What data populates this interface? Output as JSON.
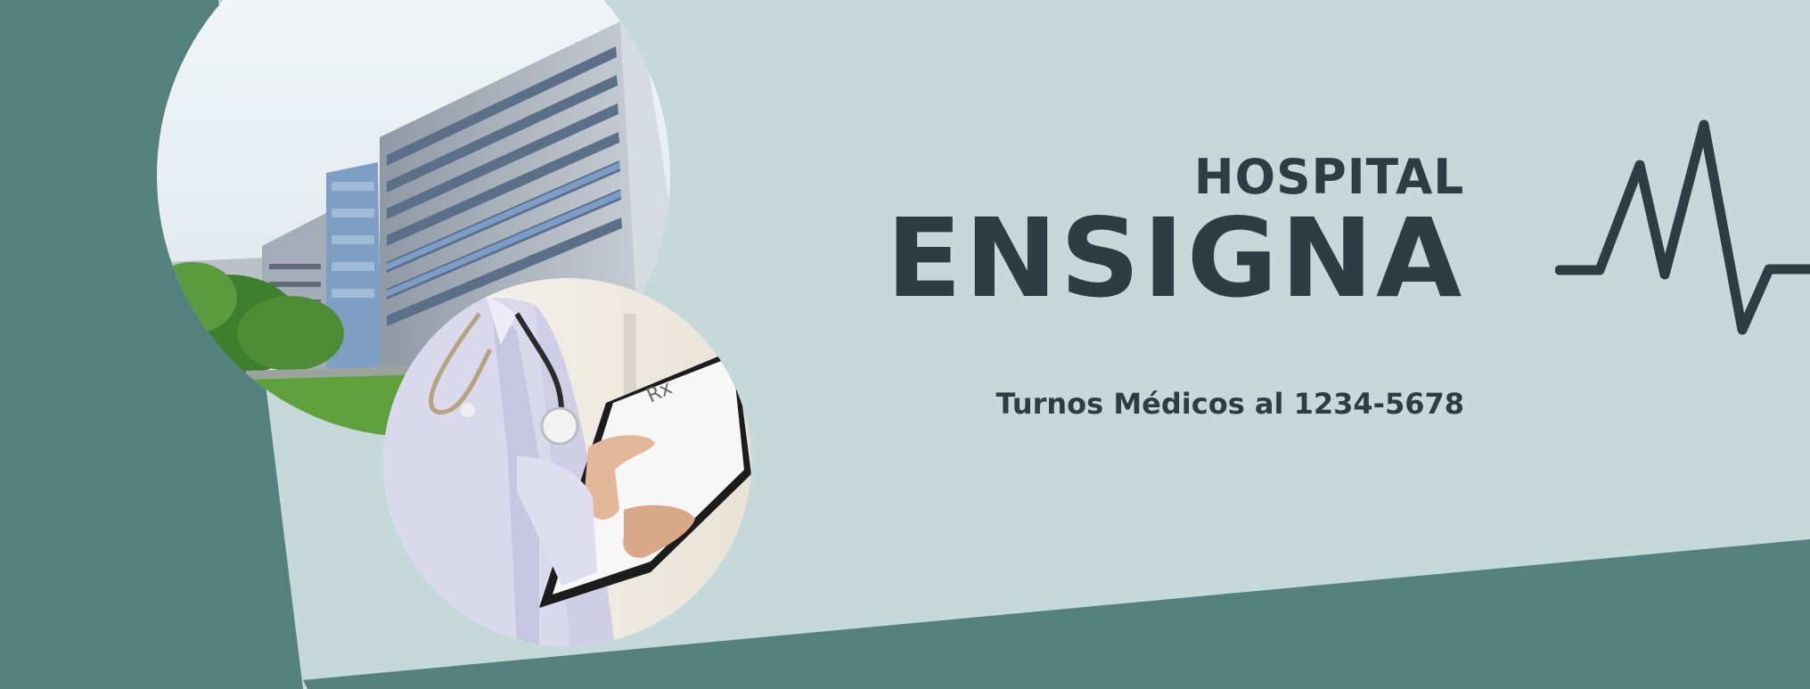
{
  "banner": {
    "title_small": "HOSPITAL",
    "title_big": "ENSIGNA",
    "subtitle": "Turnos Médicos al 1234-5678"
  },
  "images": {
    "building": "hospital-building-photo",
    "doctor": "doctor-with-stethoscope-photo"
  },
  "icons": {
    "heartbeat": "heartbeat-line-icon"
  },
  "colors": {
    "background_light": "#c5d8da",
    "accent_teal": "#54807e",
    "text_dark": "#2c3e44"
  }
}
